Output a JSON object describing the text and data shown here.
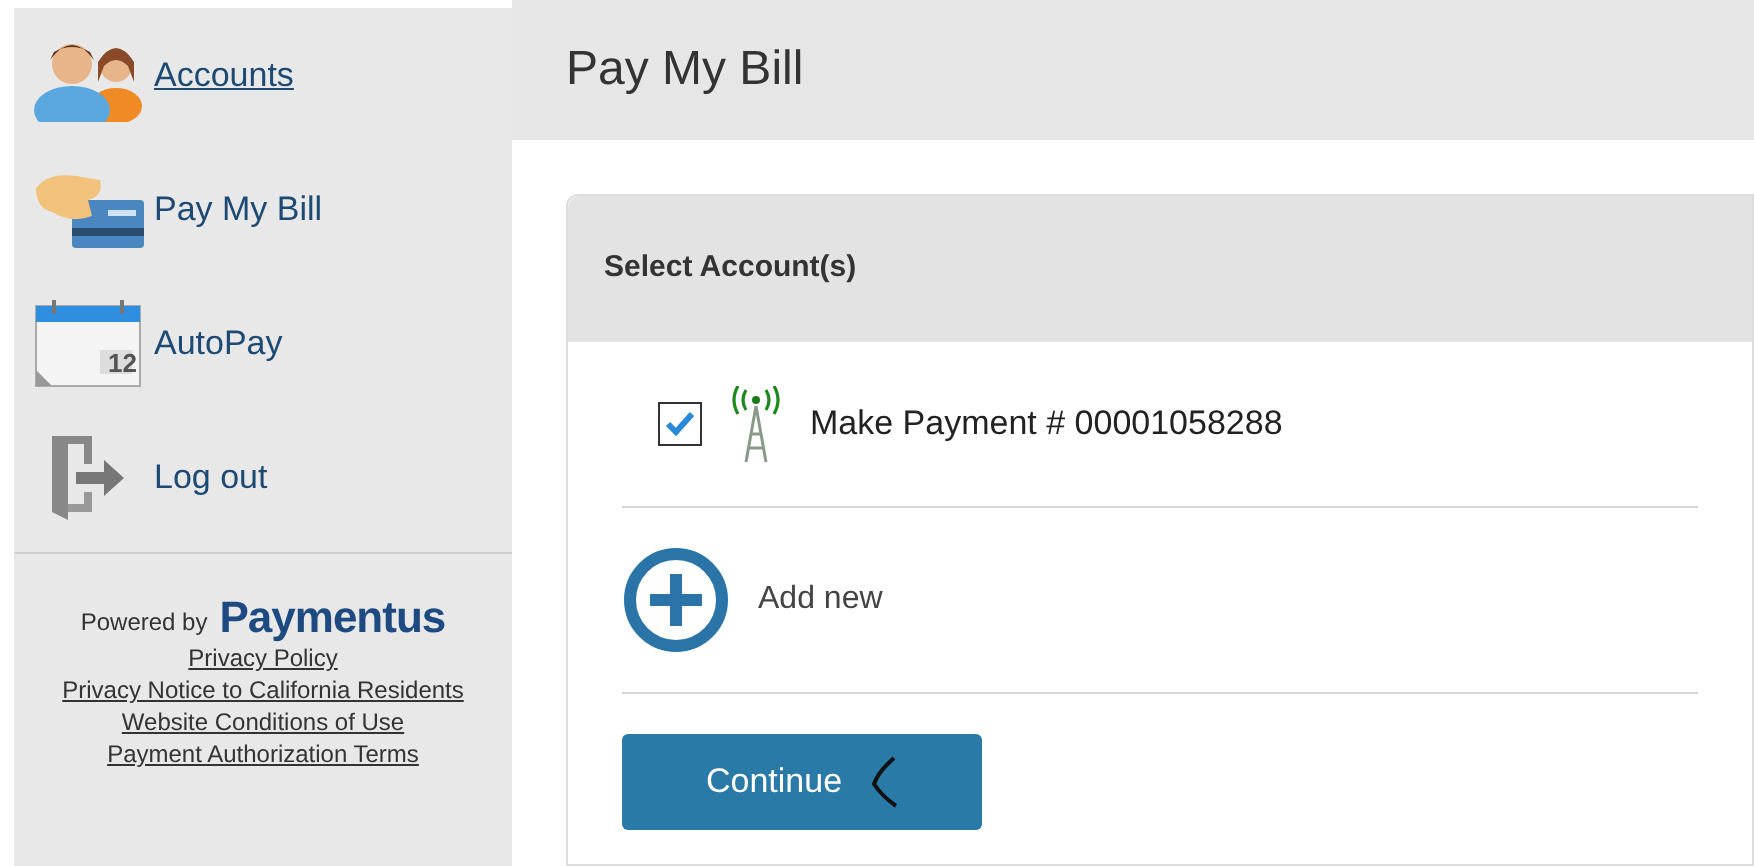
{
  "sidebar": {
    "items": [
      {
        "kind": "people",
        "label": "Accounts",
        "selected": true
      },
      {
        "kind": "card",
        "label": "Pay My Bill",
        "selected": false
      },
      {
        "kind": "calendar",
        "label": "AutoPay",
        "selected": false
      },
      {
        "kind": "logout",
        "label": "Log out",
        "selected": false
      }
    ],
    "calendar_day": "12",
    "powered_by": "Powered by",
    "brand": "Paymentus",
    "links": [
      "Privacy Policy",
      "Privacy Notice to California Residents",
      "Website Conditions of Use",
      "Payment Authorization Terms"
    ]
  },
  "page_title": "Pay My Bill",
  "card": {
    "title": "Select Account(s)",
    "accounts": [
      {
        "label": "Make Payment # 00001058288",
        "checked": true
      }
    ],
    "add_new": "Add new",
    "button": "Continue"
  }
}
